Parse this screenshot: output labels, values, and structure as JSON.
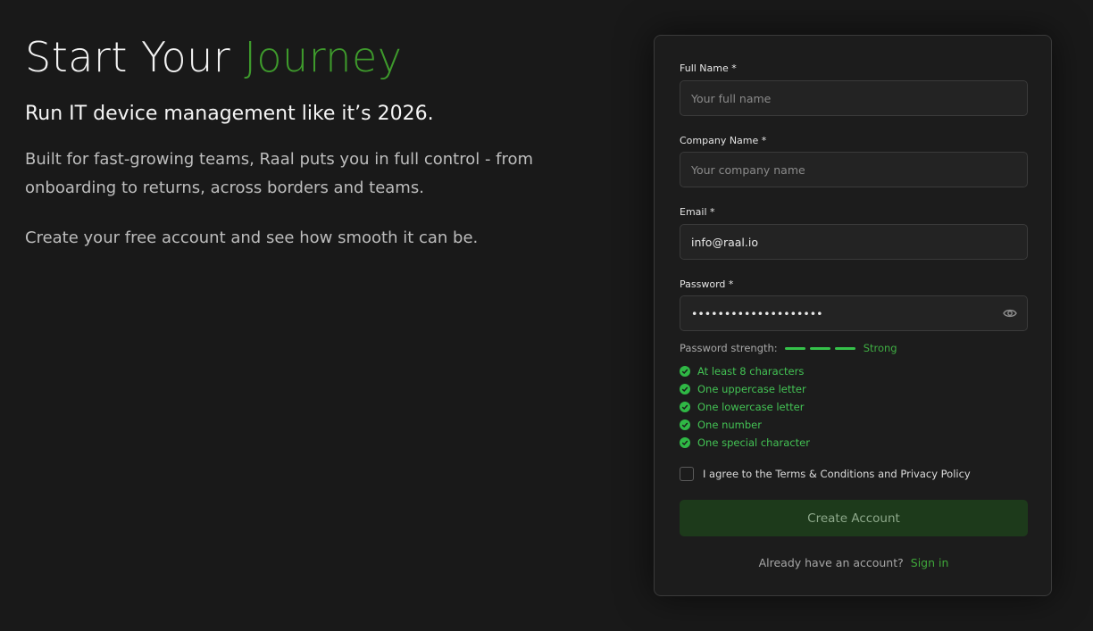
{
  "hero": {
    "title_prefix": "Start Your ",
    "title_accent": "Journey",
    "subtitle": "Run IT device management like it’s 2026.",
    "description": "Built for fast-growing teams, Raal puts you in full control - from onboarding to returns, across borders and teams.",
    "cta_text": "Create your free account and see how smooth it can be."
  },
  "form": {
    "full_name": {
      "label": "Full Name *",
      "placeholder": "Your full name",
      "value": ""
    },
    "company_name": {
      "label": "Company Name *",
      "placeholder": "Your company name",
      "value": ""
    },
    "email": {
      "label": "Email *",
      "placeholder": "",
      "value": "info@raal.io"
    },
    "password": {
      "label": "Password *",
      "value": "••••••••••••••••••••",
      "toggle_icon": "eye-icon"
    },
    "strength": {
      "label": "Password strength:",
      "level": "Strong",
      "filled_segments": 3,
      "total_segments": 3,
      "color": "#35c24a"
    },
    "requirements": [
      {
        "text": "At least 8 characters",
        "met": true
      },
      {
        "text": "One uppercase letter",
        "met": true
      },
      {
        "text": "One lowercase letter",
        "met": true
      },
      {
        "text": "One number",
        "met": true
      },
      {
        "text": "One special character",
        "met": true
      }
    ],
    "terms": {
      "label": "I agree to the Terms & Conditions and Privacy Policy",
      "checked": false
    },
    "submit_label": "Create Account",
    "signin_prompt": "Already have an account?",
    "signin_link": "Sign in"
  },
  "colors": {
    "background": "#191919",
    "accent": "#3e9a2c",
    "success": "#43c254",
    "button_bg": "#1d3a1b"
  }
}
